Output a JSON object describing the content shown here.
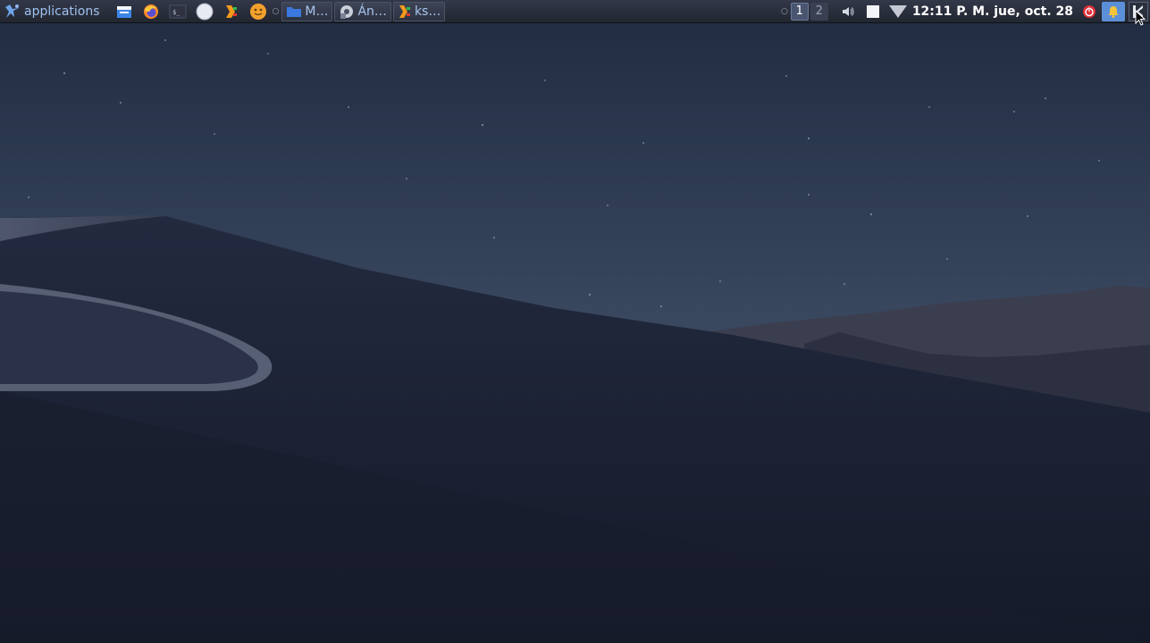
{
  "taskbar": {
    "apps_menu_label": "applications",
    "launchers": [
      {
        "icon": "file-manager-icon"
      },
      {
        "icon": "firefox-icon"
      },
      {
        "icon": "terminal-icon"
      },
      {
        "icon": "circle-app-icon"
      },
      {
        "icon": "app-launcher-icon"
      },
      {
        "icon": "face-app-icon"
      }
    ],
    "tasks": [
      {
        "label": "M…",
        "icon": "folder-icon"
      },
      {
        "label": "Án…",
        "icon": "app-gear-icon"
      },
      {
        "label": "ks…",
        "icon": "terminal-task-icon"
      }
    ],
    "workspaces": [
      "1",
      "2"
    ],
    "active_workspace": "1",
    "clock": "12:11 P. M. jue, oct. 28"
  },
  "colors": {
    "accent": "#5b90d8",
    "power_red": "#e0303a",
    "apps_label": "#9fc2ef"
  }
}
